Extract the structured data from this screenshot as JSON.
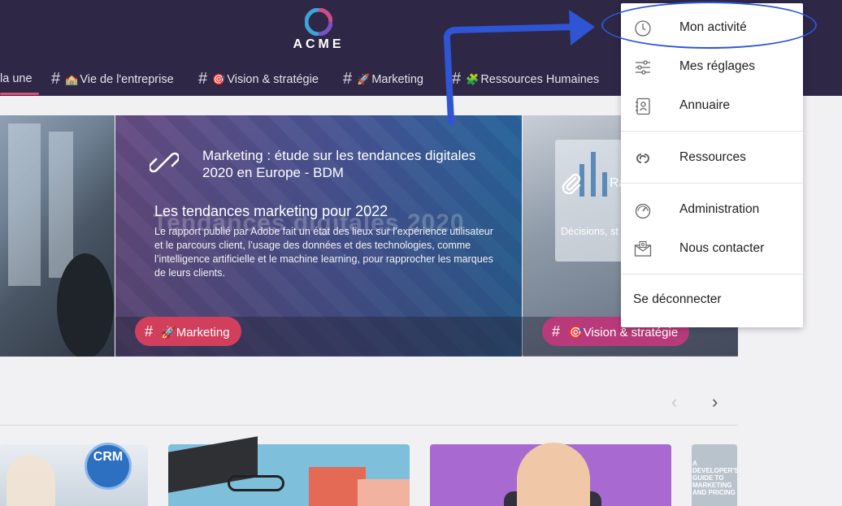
{
  "brand": {
    "name": "ACME"
  },
  "nav": {
    "items": [
      {
        "label": "la une",
        "active": true
      },
      {
        "label": "Vie de l'entreprise",
        "emoji": "🏫"
      },
      {
        "label": "Vision & stratégie",
        "emoji": "🎯"
      },
      {
        "label": "Marketing",
        "emoji": "🚀"
      },
      {
        "label": "Ressources Humaines",
        "emoji": "🧩"
      }
    ],
    "hash": "#"
  },
  "hero": {
    "link_title": "Marketing : étude sur les tendances digitales 2020 en Europe - BDM",
    "background_text": "Tendances digitales 2020",
    "article_title": "Les tendances marketing pour 2022",
    "article_desc": "Le rapport publié par Adobe fait un état des lieux sur l’expérience utilisateur et le parcours client, l’usage des données et des technologies, comme l’intelligence artificielle et le machine learning, pour rapprocher les marques de leurs clients.",
    "tag": {
      "label": "Marketing",
      "emoji": "🚀"
    },
    "right_title": "Ra",
    "right_desc": "Décisions, st",
    "right_tag": {
      "label": "Vision & stratégie",
      "emoji": "🎯"
    }
  },
  "carousel": {
    "prev": "‹",
    "next": "›"
  },
  "cards": {
    "crm_badge": "CRM",
    "book_title": "A DEVELOPER'S GUIDE TO MARKETING AND PRICING"
  },
  "menu": {
    "items": [
      {
        "label": "Mon activité",
        "icon": "clock-icon"
      },
      {
        "label": "Mes réglages",
        "icon": "sliders-icon"
      },
      {
        "label": "Annuaire",
        "icon": "contact-book-icon"
      },
      {
        "label": "Ressources",
        "icon": "resources-icon"
      },
      {
        "label": "Administration",
        "icon": "gauge-icon"
      },
      {
        "label": "Nous contacter",
        "icon": "mail-icon"
      }
    ],
    "logout": "Se déconnecter"
  },
  "colors": {
    "header_bg": "#2e2746",
    "accent": "#e44d74",
    "tag_marketing": "#d23f5d",
    "tag_vision": "#b93a7a",
    "annotation": "#2f55d4"
  }
}
